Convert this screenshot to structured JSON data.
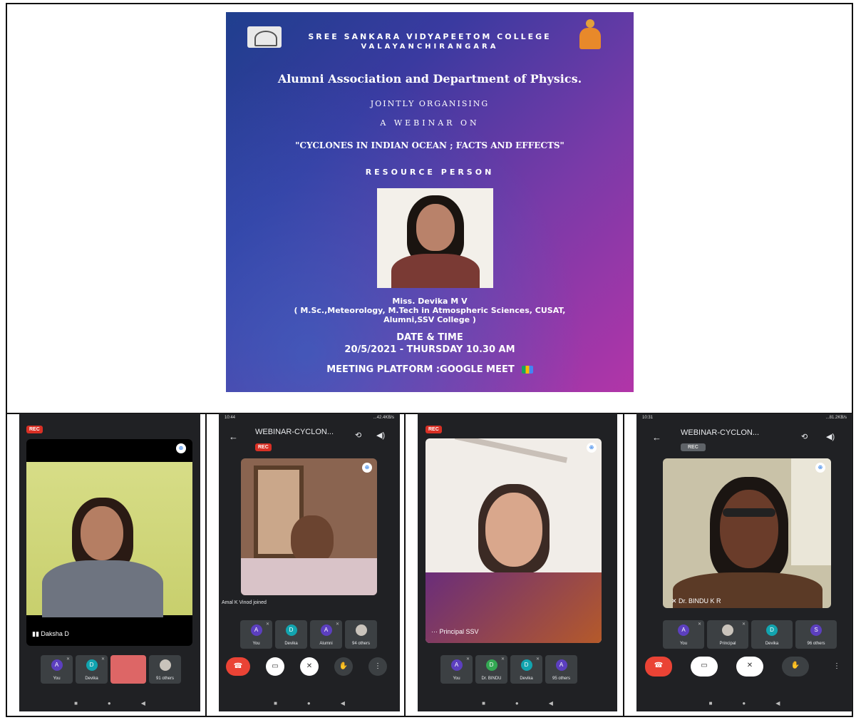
{
  "poster": {
    "college": "SREE SANKARA VIDYAPEETOM COLLEGE",
    "place": "VALAYANCHIRANGARA",
    "association": "Alumni Association and Department of Physics.",
    "jointly": "JOINTLY ORGANISING",
    "webinar_on": "A WEBINAR ON",
    "topic": "\"CYCLONES IN INDIAN OCEAN ; FACTS AND EFFECTS\"",
    "resource_heading": "RESOURCE PERSON",
    "speaker_name": "Miss. Devika M V",
    "speaker_line1": "( M.Sc.,Meteorology, M.Tech in Atmospheric Sciences, CUSAT,",
    "speaker_line2": "Alumni,SSV College )",
    "date_heading": "DATE & TIME",
    "date_value": "20/5/2021 - THURSDAY 10.30 AM",
    "platform": "MEETING PLATFORM :GOOGLE MEET"
  },
  "shot1": {
    "rec": "REC",
    "speaker": "Daksha D",
    "tiles": [
      {
        "initial": "A",
        "label": "You"
      },
      {
        "initial": "D",
        "label": "Devika"
      },
      {
        "initial": "",
        "label": ""
      },
      {
        "initial": "",
        "label": "91 others"
      }
    ]
  },
  "shot2": {
    "time": "10:44",
    "status_right": "...42.4KB/s",
    "title": "WEBINAR-CYCLON...",
    "rec": "REC",
    "joined": "Amal K Vinod joined",
    "tiles": [
      {
        "initial": "A",
        "label": "You"
      },
      {
        "initial": "D",
        "label": "Devika"
      },
      {
        "initial": "A",
        "label": "Alumni"
      },
      {
        "initial": "",
        "label": "94 others"
      }
    ]
  },
  "shot3": {
    "rec": "REC",
    "speaker": "Principal SSV",
    "tiles": [
      {
        "initial": "A",
        "label": "You"
      },
      {
        "initial": "D",
        "label": "Dr. BINDU"
      },
      {
        "initial": "D",
        "label": "Devika"
      },
      {
        "initial": "A",
        "label": "95 others"
      }
    ]
  },
  "shot4": {
    "time": "10:31",
    "status_right": "...81.2KB/s",
    "title": "WEBINAR-CYCLON...",
    "rec": "REC",
    "speaker": "Dr. BINDU K R",
    "tiles": [
      {
        "initial": "A",
        "label": "You"
      },
      {
        "initial": "",
        "label": "Principal"
      },
      {
        "initial": "D",
        "label": "Devika"
      },
      {
        "initial": "S",
        "label": "96 others"
      }
    ]
  },
  "colors": {
    "meet_bg": "#202124",
    "tile_bg": "#3c4043",
    "rec_red": "#d93025",
    "end_call_red": "#ea4335",
    "avatar_purple": "#5c3fbf",
    "avatar_teal": "#12a4af",
    "avatar_green": "#34a853"
  },
  "icons": [
    "pin-icon",
    "mic-off-icon",
    "end-call-icon",
    "camera-off-icon",
    "mic-icon",
    "raise-hand-icon",
    "more-icon",
    "back-arrow-icon",
    "switch-camera-icon",
    "speaker-icon"
  ]
}
